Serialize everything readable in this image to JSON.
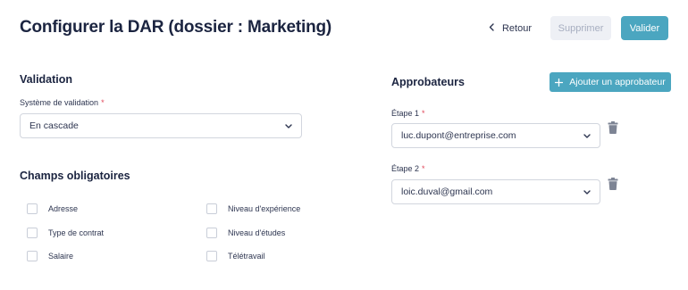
{
  "header": {
    "title": "Configurer la DAR (dossier : Marketing)",
    "back_label": "Retour",
    "delete_label": "Supprimer",
    "validate_label": "Valider"
  },
  "validation": {
    "title": "Validation",
    "system_label": "Système de validation",
    "required_mark": "*",
    "system_value": "En cascade"
  },
  "required_fields": {
    "title": "Champs obligatoires",
    "items": [
      {
        "label": "Adresse",
        "checked": false
      },
      {
        "label": "Type de contrat",
        "checked": false
      },
      {
        "label": "Salaire",
        "checked": false
      },
      {
        "label": "Niveau d'expérience",
        "checked": false
      },
      {
        "label": "Niveau d'études",
        "checked": false
      },
      {
        "label": "Télétravail",
        "checked": false
      }
    ]
  },
  "approvers": {
    "title": "Approbateurs",
    "add_label": "Ajouter un approbateur",
    "steps": [
      {
        "label": "Étape 1",
        "required_mark": "*",
        "value": "luc.dupont@entreprise.com"
      },
      {
        "label": "Étape 2",
        "required_mark": "*",
        "value": "loic.duval@gmail.com"
      }
    ]
  },
  "icons": {
    "back": "chevron-left-icon",
    "dropdown": "chevron-down-icon",
    "add": "plus-icon",
    "delete": "trash-icon"
  },
  "colors": {
    "accent": "#4ba6c0",
    "required": "#e0475a",
    "title": "#1b2440",
    "disabled_bg": "#eef0f5",
    "disabled_text": "#a7aec0"
  }
}
